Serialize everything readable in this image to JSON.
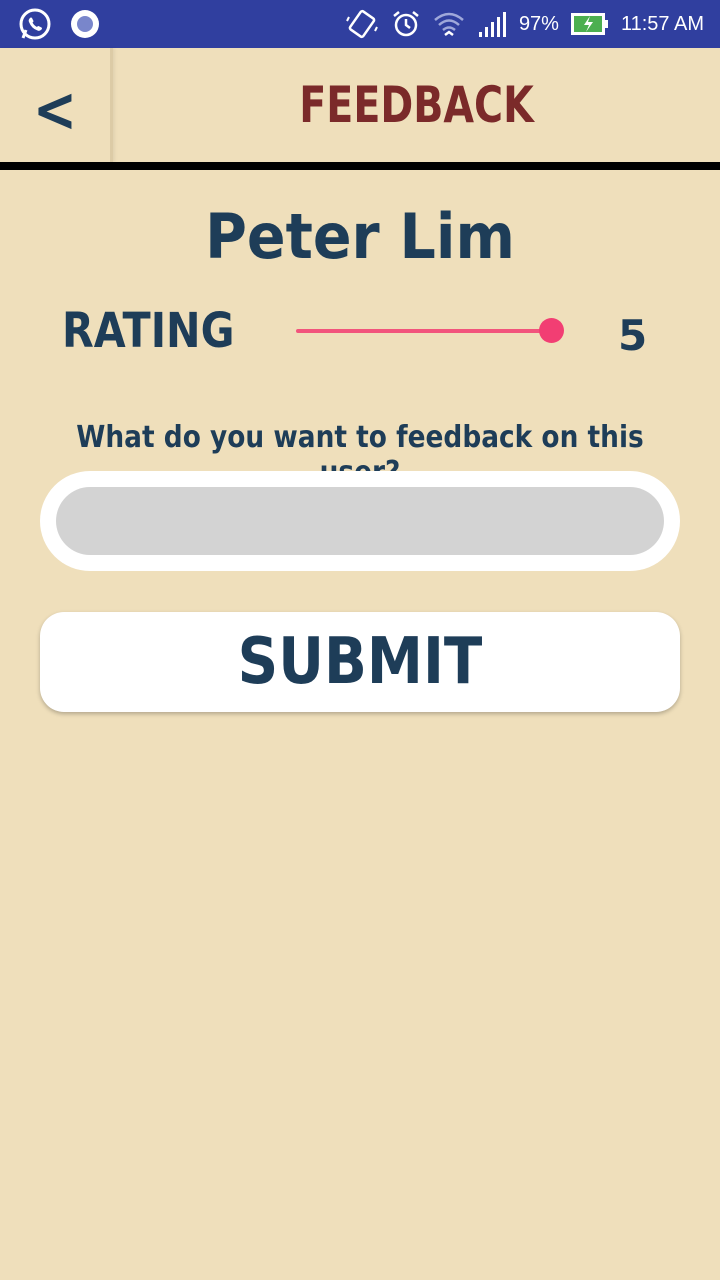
{
  "status_bar": {
    "battery": "97%",
    "time": "11:57 AM",
    "icons": [
      "whatsapp-icon",
      "chat-bubble-icon",
      "vibrate-icon",
      "alarm-icon",
      "wifi-icon",
      "signal-icon",
      "battery-charging-icon"
    ],
    "background": "#303F9F"
  },
  "header": {
    "back_label": "<",
    "title": "FEEDBACK"
  },
  "profile": {
    "name": "Peter Lim"
  },
  "rating": {
    "label": "RATING",
    "value": "5",
    "slider_fraction": 1.0,
    "accent_color": "#F23E73"
  },
  "feedback": {
    "question": "What do you want to feedback on this user?",
    "input_value": "",
    "placeholder": ""
  },
  "submit_label": "SUBMIT",
  "colors": {
    "background": "#EFDFBB",
    "text_primary": "#1E3D58",
    "title": "#7B2A2A"
  }
}
